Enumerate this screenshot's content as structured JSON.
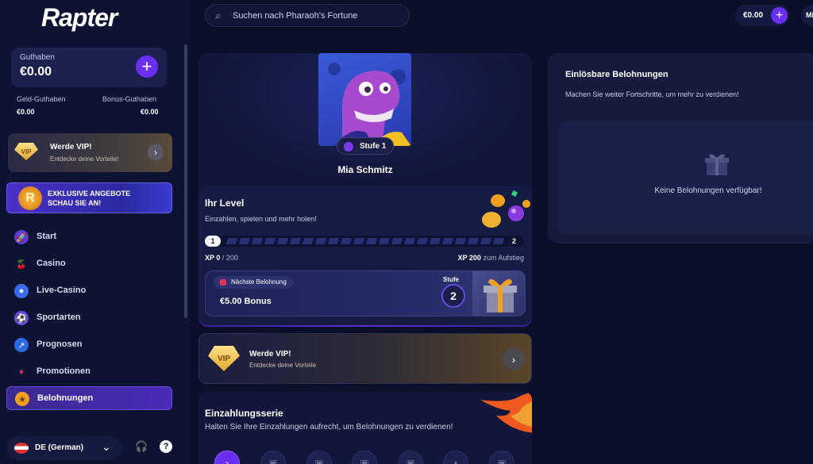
{
  "app": {
    "logo": "Rapter"
  },
  "search": {
    "placeholder": "Suchen nach Pharaoh's Fortune"
  },
  "topbar": {
    "balance": "€0.00",
    "user_initials": "Mi"
  },
  "wallet": {
    "label": "Guthaben",
    "total": "€0.00",
    "cash_label": "Geld-Guthaben",
    "cash_value": "€0.00",
    "bonus_label": "Bonus-Guthaben",
    "bonus_value": "€0.00"
  },
  "sidebar_vip": {
    "badge": "VIP",
    "title": "Werde VIP!",
    "subtitle": "Entdecke deine Vorteile!"
  },
  "sidebar_promo": {
    "coin": "R",
    "line1": "EXKLUSIVE ANGEBOTE",
    "line2": "SCHAU SIE AN!"
  },
  "nav": {
    "items": [
      {
        "label": "Start",
        "icon": "rocket-icon",
        "color": "#7a5af0"
      },
      {
        "label": "Casino",
        "icon": "cherries-icon",
        "color": "#e04060"
      },
      {
        "label": "Live-Casino",
        "icon": "chip-icon",
        "color": "#3a6af0"
      },
      {
        "label": "Sportarten",
        "icon": "ball-icon",
        "color": "#6a4ae0"
      },
      {
        "label": "Prognosen",
        "icon": "trend-icon",
        "color": "#3a8af0"
      },
      {
        "label": "Promotionen",
        "icon": "gem-icon",
        "color": "#e03060"
      },
      {
        "label": "Belohnungen",
        "icon": "medal-icon",
        "color": "#f0a020"
      }
    ],
    "active": "Belohnungen"
  },
  "footer": {
    "language": "DE (German)",
    "help": "?"
  },
  "profile": {
    "level_badge": "Stufe 1",
    "name": "Mia Schmitz",
    "level_title": "Ihr Level",
    "level_subtitle": "Einzahlen, spielen und mehr holen!",
    "progress_start": "1",
    "progress_end": "2",
    "progress_fraction": 0,
    "xp_current_label": "XP 0",
    "xp_current_total": "/ 200",
    "xp_next_label": "XP 200",
    "xp_next_suffix": "zum Aufstieg",
    "next_reward_tag": "Nächste Belohnung",
    "next_reward_value": "€5.00 Bonus",
    "stage_label": "Stufe",
    "stage_number": "2"
  },
  "vip_banner": {
    "badge": "VIP",
    "title": "Werde VIP!",
    "subtitle": "Entdecke deine Vorteile"
  },
  "streak": {
    "title": "Einzahlungsserie",
    "subtitle": "Halten Sie Ihre Einzahlungen aufrecht, um Belohnungen zu verdienen!"
  },
  "rewards_panel": {
    "title": "Einlösbare Belohnungen",
    "subtitle": "Machen Sie weiter Fortschritte, um mehr zu verdienen!",
    "empty_text": "Keine Belohnungen verfügbar!"
  }
}
